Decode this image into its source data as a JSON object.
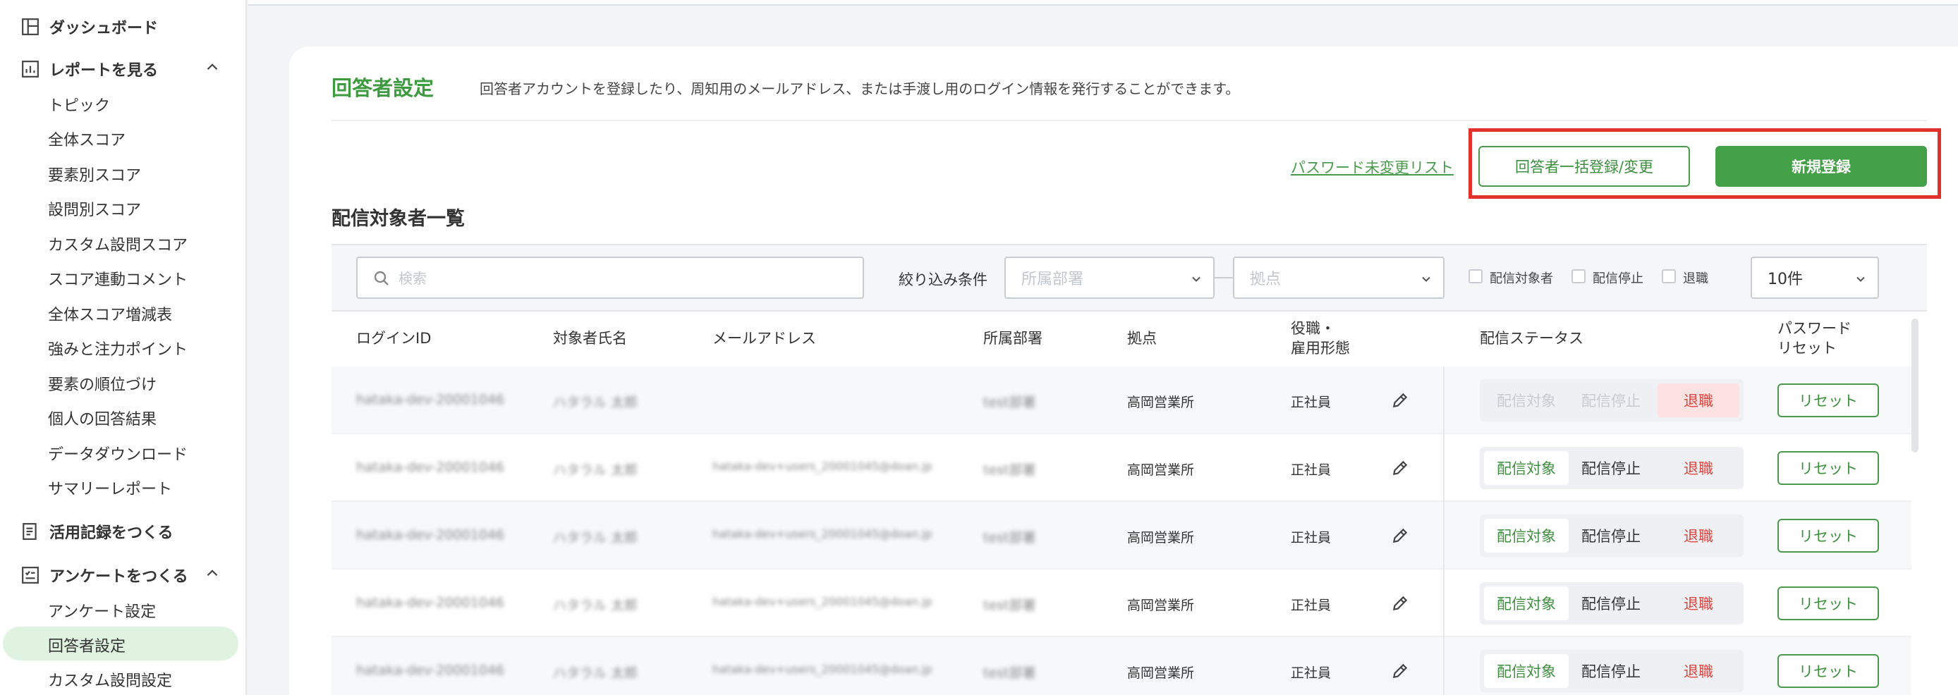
{
  "sidebar": {
    "groups": [
      {
        "label": "ダッシュボード",
        "icon": "dashboard-icon"
      },
      {
        "label": "レポートを見る",
        "icon": "report-chart-icon"
      },
      {
        "label": "活用記録をつくる",
        "icon": "record-document-icon"
      },
      {
        "label": "アンケートをつくる",
        "icon": "survey-checklist-icon"
      }
    ],
    "report_items": [
      "トピック",
      "全体スコア",
      "要素別スコア",
      "設問別スコア",
      "カスタム設問スコア",
      "スコア連動コメント",
      "全体スコア増減表",
      "強みと注力ポイント",
      "要素の順位づけ",
      "個人の回答結果",
      "データダウンロード",
      "サマリーレポート"
    ],
    "survey_items": [
      "アンケート設定",
      "回答者設定",
      "カスタム設問設定"
    ],
    "active_item": "回答者設定"
  },
  "page": {
    "title": "回答者設定",
    "description": "回答者アカウントを登録したり、周知用のメールアドレス、または手渡し用のログイン情報を発行することができます。"
  },
  "actions": {
    "password_link": "パスワード未変更リスト",
    "bulk_button": "回答者一括登録/変更",
    "new_button": "新規登録"
  },
  "section_title": "配信対象者一覧",
  "filters": {
    "search_placeholder": "検索",
    "filter_label": "絞り込み条件",
    "department_placeholder": "所属部署",
    "location_placeholder": "拠点",
    "checkbox_target": "配信対象者",
    "checkbox_stopped": "配信停止",
    "checkbox_retired": "退職",
    "per_page": "10件"
  },
  "table": {
    "headers": {
      "login_id": "ログインID",
      "name": "対象者氏名",
      "email": "メールアドレス",
      "department": "所属部署",
      "location": "拠点",
      "position_line1": "役職・",
      "position_line2": "雇用形態",
      "status": "配信ステータス",
      "reset_line1": "パスワード",
      "reset_line2": "リセット"
    },
    "rows": [
      {
        "login_id": "hataka-dev-20001046",
        "name": "ハタラル 太郎",
        "email": "",
        "department": "test部署",
        "location": "高岡営業所",
        "position": "正社員",
        "status": "retired"
      },
      {
        "login_id": "hataka-dev-20001046",
        "name": "ハタラル 太郎",
        "email": "hataka-dev+users_20001045@doan.jp",
        "department": "test部署",
        "location": "高岡営業所",
        "position": "正社員",
        "status": "target"
      },
      {
        "login_id": "hataka-dev-20001046",
        "name": "ハタラル 太郎",
        "email": "hataka-dev+users_20001045@doan.jp",
        "department": "test部署",
        "location": "高岡営業所",
        "position": "正社員",
        "status": "target"
      },
      {
        "login_id": "hataka-dev-20001046",
        "name": "ハタラル 太郎",
        "email": "hataka-dev+users_20001045@doan.jp",
        "department": "test部署",
        "location": "高岡営業所",
        "position": "正社員",
        "status": "target"
      },
      {
        "login_id": "hataka-dev-20001046",
        "name": "ハタラル 太郎",
        "email": "hataka-dev+users_20001045@doan.jp",
        "department": "test部署",
        "location": "高岡営業所",
        "position": "正社員",
        "status": "target"
      }
    ],
    "status_labels": {
      "target": "配信対象",
      "stopped": "配信停止",
      "retired": "退職"
    },
    "reset_label": "リセット"
  },
  "colors": {
    "accent": "#43a047",
    "accent_text": "#3d9b3f",
    "highlight": "#e0322b",
    "retired": "#e0443e"
  }
}
